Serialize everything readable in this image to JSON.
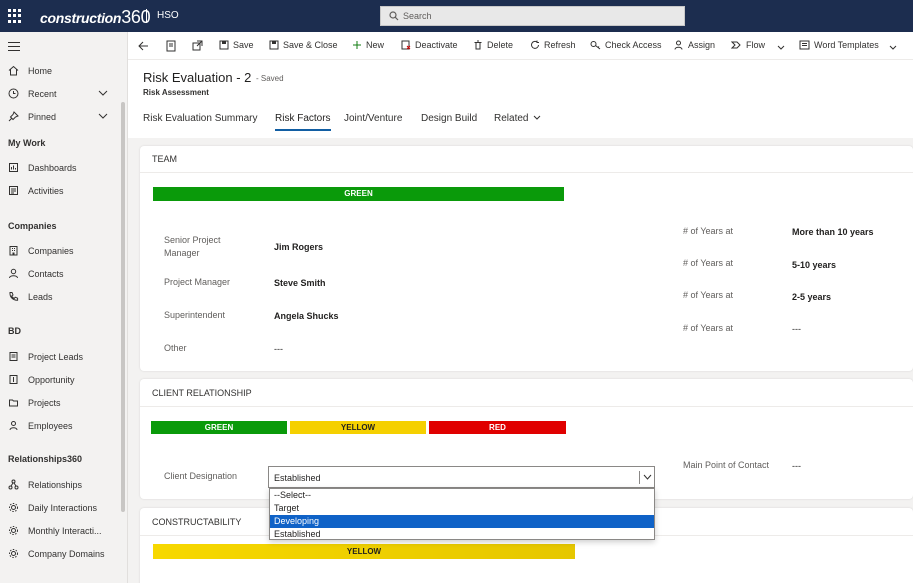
{
  "topbar": {
    "brand": "construction",
    "brand_num": "360",
    "org": "HSO",
    "search_placeholder": "Search"
  },
  "sidebar": {
    "top": [
      {
        "label": "Home",
        "icon": "home-icon"
      },
      {
        "label": "Recent",
        "icon": "clock-icon"
      },
      {
        "label": "Pinned",
        "icon": "pin-icon"
      }
    ],
    "groups": [
      {
        "title": "My Work",
        "items": [
          "Dashboards",
          "Activities"
        ]
      },
      {
        "title": "Companies",
        "items": [
          "Companies",
          "Contacts",
          "Leads"
        ]
      },
      {
        "title": "BD",
        "items": [
          "Project Leads",
          "Opportunity",
          "Projects",
          "Employees"
        ]
      },
      {
        "title": "Relationships360",
        "items": [
          "Relationships",
          "Daily Interactions",
          "Monthly Interacti...",
          "Company Domains"
        ]
      }
    ]
  },
  "commands": [
    "Save",
    "Save & Close",
    "New",
    "Deactivate",
    "Delete",
    "Refresh",
    "Check Access",
    "Assign",
    "Flow",
    "Word Templates"
  ],
  "record": {
    "title": "Risk Evaluation - 2",
    "saved": "- Saved",
    "entity": "Risk Assessment",
    "tabs": [
      "Risk Evaluation Summary",
      "Risk Factors",
      "Joint/Venture",
      "Design Build",
      "Related"
    ]
  },
  "team": {
    "title": "TEAM",
    "bar": "GREEN",
    "fields": [
      {
        "label_1": "Senior Project",
        "label_2": "Manager",
        "value": "Jim Rogers"
      },
      {
        "label_1": "Project Manager",
        "label_2": "",
        "value": "Steve Smith"
      },
      {
        "label_1": "Superintendent",
        "label_2": "",
        "value": "Angela Shucks"
      },
      {
        "label_1": "Other",
        "label_2": "",
        "value": "---"
      }
    ],
    "years_label": "# of Years at",
    "years": [
      "More than 10 years",
      "5-10 years",
      "2-5 years",
      "---"
    ]
  },
  "client": {
    "title": "CLIENT RELATIONSHIP",
    "bars": [
      "GREEN",
      "YELLOW",
      "RED"
    ],
    "designation_label": "Client Designation",
    "designation_value": "Established",
    "contact_label": "Main Point of Contact",
    "contact_value": "---",
    "options": [
      "--Select--",
      "Target",
      "Developing",
      "Established"
    ],
    "highlighted": "Developing"
  },
  "constructability": {
    "title": "CONSTRUCTABILITY",
    "bar": "YELLOW"
  },
  "colors": {
    "green": "#0a9a0a",
    "yellow": "#f5d000",
    "red": "#e00000",
    "accent": "#115ea3",
    "topbar": "#1c2d4f"
  }
}
